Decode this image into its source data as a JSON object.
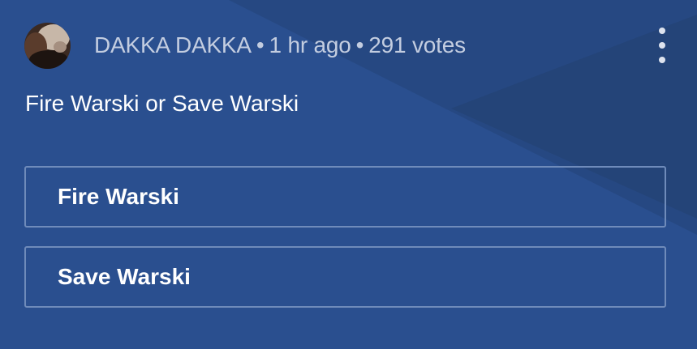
{
  "post": {
    "author": "DAKKA DAKKA",
    "time": "1 hr ago",
    "votes": "291 votes",
    "separator": "•",
    "question": "Fire Warski or Save Warski"
  },
  "poll": {
    "options": [
      {
        "label": "Fire Warski"
      },
      {
        "label": "Save Warski"
      }
    ]
  },
  "icons": {
    "menu": "more-vertical-icon",
    "avatar": "user-avatar"
  },
  "colors": {
    "background": "#2a4f8f",
    "option_border": "#6f8bba",
    "meta_text": "#c3cde0",
    "text": "#ffffff"
  }
}
